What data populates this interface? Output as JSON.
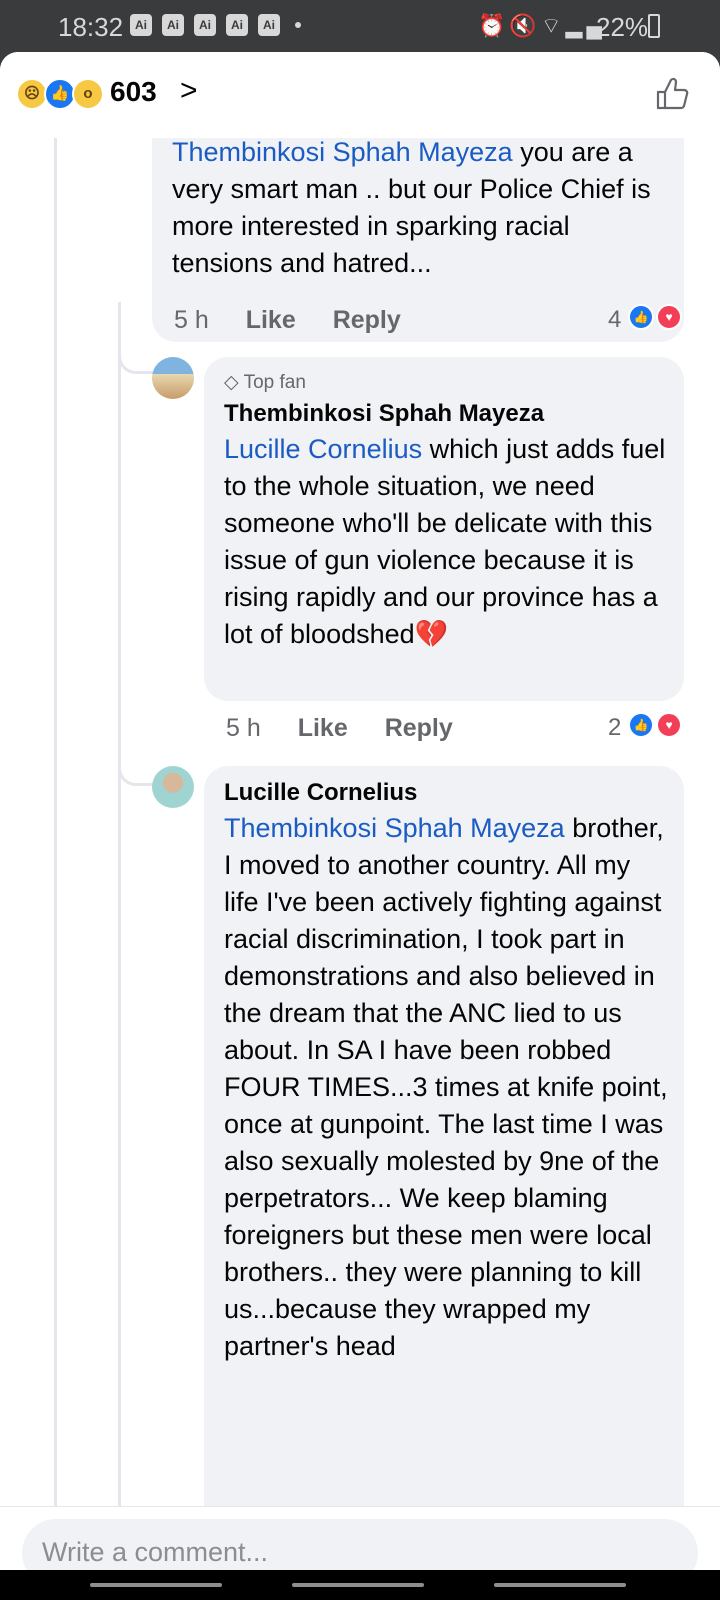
{
  "status_bar": {
    "time": "18:32",
    "ai_badges": [
      "Ai",
      "Ai",
      "Ai",
      "Ai",
      "Ai"
    ],
    "icons": [
      "alarm-icon",
      "mute-icon",
      "wifi-icon",
      "signal-icon"
    ],
    "battery": "22%"
  },
  "header": {
    "reactions": [
      "sad",
      "like",
      "wow"
    ],
    "reaction_count": "603",
    "chevron": ">"
  },
  "comments": [
    {
      "mention": "Thembinkosi Sphah Mayeza",
      "text": " you are a very smart man .. but our Police Chief is more interested in sparking racial tensions and hatred...",
      "time": "5 h",
      "like_label": "Like",
      "reply_label": "Reply",
      "reaction_count": "4"
    },
    {
      "badge": "Top fan",
      "author": "Thembinkosi Sphah Mayeza",
      "mention": "Lucille Cornelius",
      "text": " which just adds fuel to the whole situation, we need someone who'll be delicate with this issue of gun violence because it is rising rapidly and our province has a lot of bloodshed",
      "emoji": "💔",
      "time": "5 h",
      "like_label": "Like",
      "reply_label": "Reply",
      "reaction_count": "2"
    },
    {
      "author": "Lucille Cornelius",
      "mention": "Thembinkosi Sphah Mayeza",
      "text": " brother, I moved to another country. All my life I've been actively fighting against racial discrimination, I took part in demonstrations and also believed in the dream that the ANC lied to us about. In SA I have been robbed FOUR TIMES...3 times at knife point, once at gunpoint. The last time I was also sexually molested by 9ne of the perpetrators... We keep blaming foreigners but these men were local brothers.. they were planning to kill us...because they wrapped my partner's head"
    }
  ],
  "composer": {
    "placeholder": "Write a comment..."
  },
  "colors": {
    "mention": "#1a5bc4",
    "bubble": "#f0f2f5",
    "like_blue": "#1877f2",
    "love_red": "#f33e58"
  }
}
